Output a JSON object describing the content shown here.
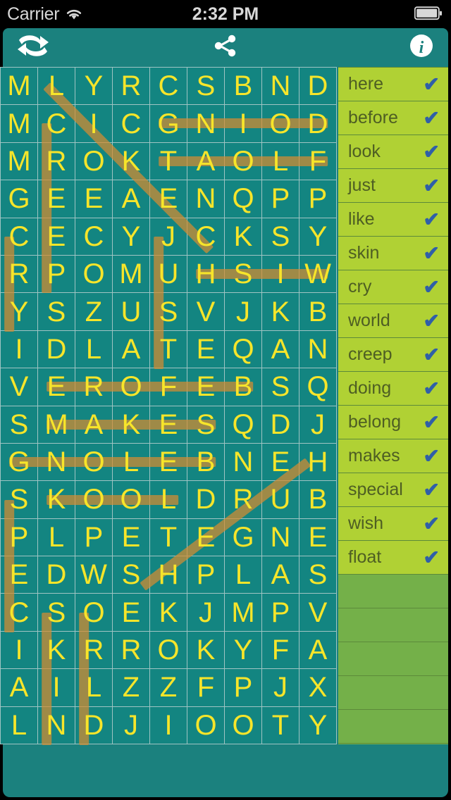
{
  "statusbar": {
    "carrier": "Carrier",
    "wifi_icon": "wifi-icon",
    "time": "2:32 PM",
    "battery_icon": "battery-icon"
  },
  "toolbar": {
    "shuffle_icon": "shuffle-icon",
    "share_icon": "share-icon",
    "info_icon": "info-icon"
  },
  "grid": {
    "columns": 9,
    "rows": 18,
    "letters": [
      "M",
      "L",
      "Y",
      "R",
      "C",
      "S",
      "B",
      "N",
      "D",
      "M",
      "C",
      "I",
      "C",
      "G",
      "N",
      "I",
      "O",
      "D",
      "M",
      "R",
      "O",
      "K",
      "T",
      "A",
      "O",
      "L",
      "F",
      "G",
      "E",
      "E",
      "A",
      "E",
      "N",
      "Q",
      "P",
      "P",
      "C",
      "E",
      "C",
      "Y",
      "J",
      "C",
      "K",
      "S",
      "Y",
      "R",
      "P",
      "O",
      "M",
      "U",
      "H",
      "S",
      "I",
      "W",
      "Y",
      "S",
      "Z",
      "U",
      "S",
      "V",
      "J",
      "K",
      "B",
      "I",
      "D",
      "L",
      "A",
      "T",
      "E",
      "Q",
      "A",
      "N",
      "V",
      "E",
      "R",
      "O",
      "F",
      "E",
      "B",
      "S",
      "Q",
      "S",
      "M",
      "A",
      "K",
      "E",
      "S",
      "Q",
      "D",
      "J",
      "G",
      "N",
      "O",
      "L",
      "E",
      "B",
      "N",
      "E",
      "H",
      "S",
      "K",
      "O",
      "O",
      "L",
      "D",
      "R",
      "U",
      "B",
      "P",
      "L",
      "P",
      "E",
      "T",
      "E",
      "G",
      "N",
      "E",
      "E",
      "D",
      "W",
      "S",
      "H",
      "P",
      "L",
      "A",
      "S",
      "C",
      "S",
      "O",
      "E",
      "K",
      "J",
      "M",
      "P",
      "V",
      "I",
      "K",
      "R",
      "R",
      "O",
      "K",
      "Y",
      "F",
      "A",
      "A",
      "I",
      "L",
      "Z",
      "Z",
      "F",
      "P",
      "J",
      "X",
      "L",
      "N",
      "D",
      "J",
      "I",
      "O",
      "O",
      "T",
      "Y"
    ],
    "colors": {
      "cell_bg": "#138581",
      "letter": "#f7e52a",
      "gridline": "#9fc4c3",
      "highlight": "#d68c30"
    },
    "highlights": [
      {
        "word": "like",
        "r1": 0,
        "c1": 1,
        "r2": 4,
        "c2": 5
      },
      {
        "word": "doing",
        "r1": 1,
        "c1": 4,
        "r2": 1,
        "c2": 8
      },
      {
        "word": "float",
        "r1": 2,
        "c1": 4,
        "r2": 2,
        "c2": 8
      },
      {
        "word": "creep",
        "r1": 1,
        "c1": 1,
        "r2": 5,
        "c2": 1
      },
      {
        "word": "cry",
        "r1": 4,
        "c1": 0,
        "r2": 6,
        "c2": 0
      },
      {
        "word": "just",
        "r1": 4,
        "c1": 4,
        "r2": 7,
        "c2": 4
      },
      {
        "word": "wish",
        "r1": 5,
        "c1": 5,
        "r2": 5,
        "c2": 8
      },
      {
        "word": "before",
        "r1": 8,
        "c1": 1,
        "r2": 8,
        "c2": 6
      },
      {
        "word": "makes",
        "r1": 9,
        "c1": 1,
        "r2": 9,
        "c2": 5
      },
      {
        "word": "belong",
        "r1": 10,
        "c1": 0,
        "r2": 10,
        "c2": 5
      },
      {
        "word": "look",
        "r1": 11,
        "c1": 1,
        "r2": 11,
        "c2": 4
      },
      {
        "word": "here",
        "r1": 11,
        "c1": 0,
        "r2": 14,
        "c2": 0
      },
      {
        "word": "special",
        "r1": 10,
        "c1": 8,
        "r2": 13,
        "c2": 4
      },
      {
        "word": "world",
        "r1": 14,
        "c1": 1,
        "r2": 17,
        "c2": 1
      },
      {
        "word": "skin",
        "r1": 14,
        "c1": 2,
        "r2": 17,
        "c2": 2
      }
    ]
  },
  "wordlist": {
    "check_symbol": "✔",
    "found_bg": "#b0d134",
    "empty_bg": "#74b049",
    "check_color": "#2f5fa8",
    "words": [
      {
        "label": "here",
        "found": true
      },
      {
        "label": "before",
        "found": true
      },
      {
        "label": "look",
        "found": true
      },
      {
        "label": "just",
        "found": true
      },
      {
        "label": "like",
        "found": true
      },
      {
        "label": "skin",
        "found": true
      },
      {
        "label": "cry",
        "found": true
      },
      {
        "label": "world",
        "found": true
      },
      {
        "label": "creep",
        "found": true
      },
      {
        "label": "doing",
        "found": true
      },
      {
        "label": "belong",
        "found": true
      },
      {
        "label": "makes",
        "found": true
      },
      {
        "label": "special",
        "found": true
      },
      {
        "label": "wish",
        "found": true
      },
      {
        "label": "float",
        "found": true
      },
      {
        "label": "",
        "found": false
      },
      {
        "label": "",
        "found": false
      },
      {
        "label": "",
        "found": false
      },
      {
        "label": "",
        "found": false
      },
      {
        "label": "",
        "found": false
      }
    ]
  }
}
